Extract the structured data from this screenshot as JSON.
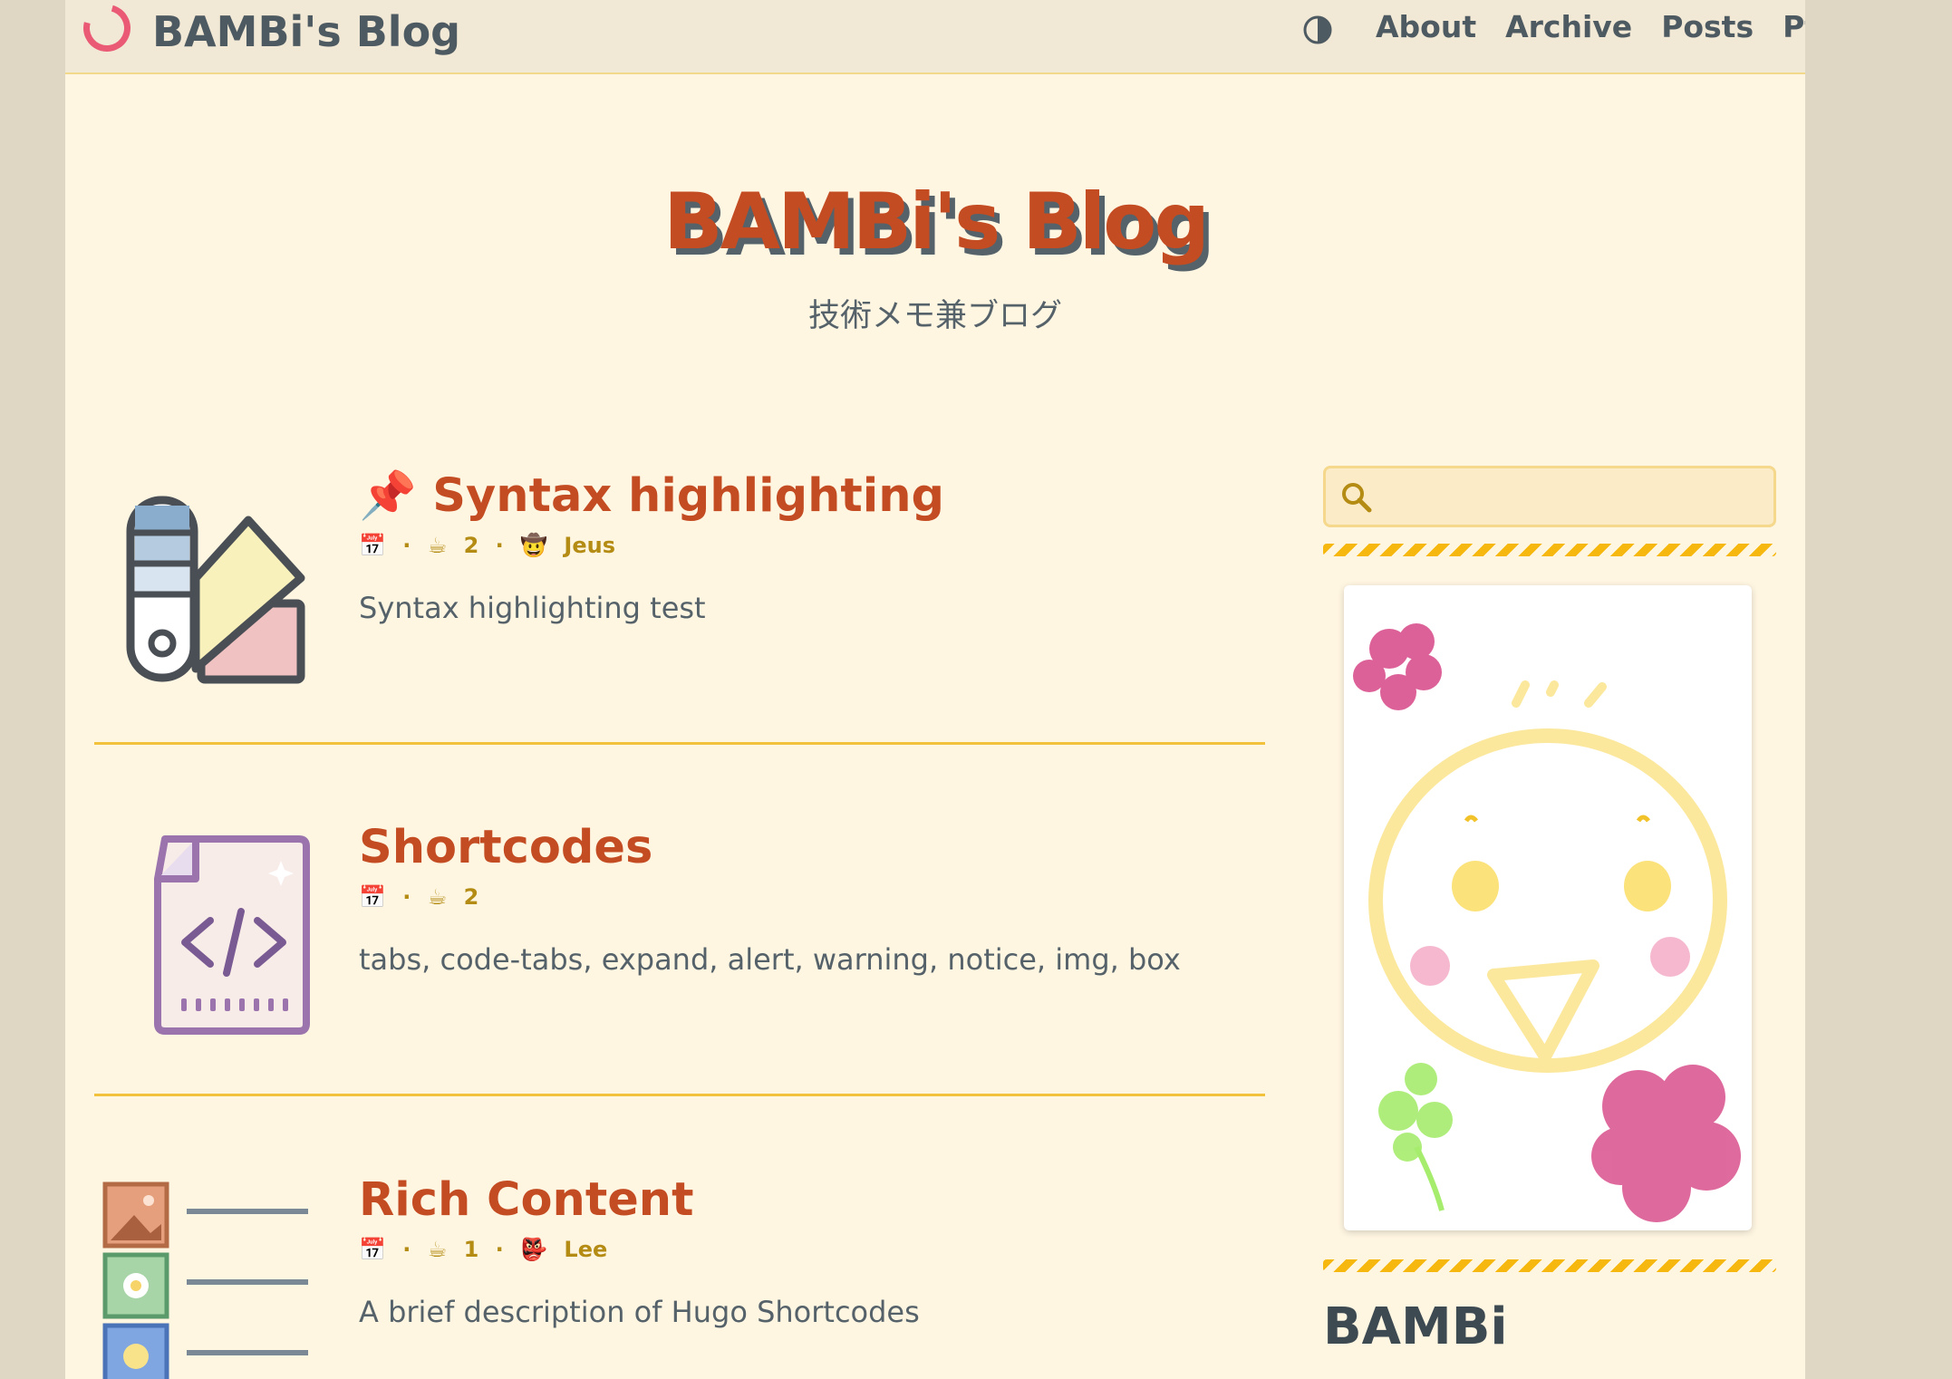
{
  "site": {
    "name": "BAMBi's Blog"
  },
  "nav": {
    "theme_toggle_icon": "contrast-icon",
    "items": [
      "About",
      "Archive",
      "Posts",
      "Pt"
    ]
  },
  "hero": {
    "title": "BAMBi's Blog",
    "subtitle": "技術メモ兼ブログ"
  },
  "posts": [
    {
      "pin": "📌",
      "title": "Syntax highlighting",
      "meta": {
        "calendar": "📅",
        "sep": "·",
        "coffee": "☕",
        "read_count": "2",
        "author_icon": "🤠",
        "author": "Jeus"
      },
      "summary": "Syntax highlighting test",
      "thumb_icon": "color-swatch-icon"
    },
    {
      "title": "Shortcodes",
      "meta": {
        "calendar": "📅",
        "sep": "·",
        "coffee": "☕",
        "read_count": "2"
      },
      "summary": "tabs, code-tabs, expand, alert, warning, notice, img, box",
      "thumb_icon": "code-file-icon"
    },
    {
      "title": "Rich Content",
      "meta": {
        "calendar": "📅",
        "sep": "·",
        "coffee": "☕",
        "read_count": "1",
        "author_icon": "👺",
        "author": "Lee"
      },
      "summary": "A brief description of Hugo Shortcodes",
      "thumb_icon": "image-gallery-icon"
    }
  ],
  "sidebar": {
    "search": {
      "placeholder": "",
      "icon": "search-icon"
    },
    "author": {
      "name": "BAMBi",
      "avatar": "chick-drawing-avatar"
    }
  },
  "colors": {
    "accent": "#c44c22",
    "page_bg": "#fff6e2",
    "outer_bg": "#dfd7c4",
    "topbar_bg": "#f1e8d5",
    "meta": "#b48c14",
    "divider": "#f2c23c",
    "text": "#56626a"
  }
}
